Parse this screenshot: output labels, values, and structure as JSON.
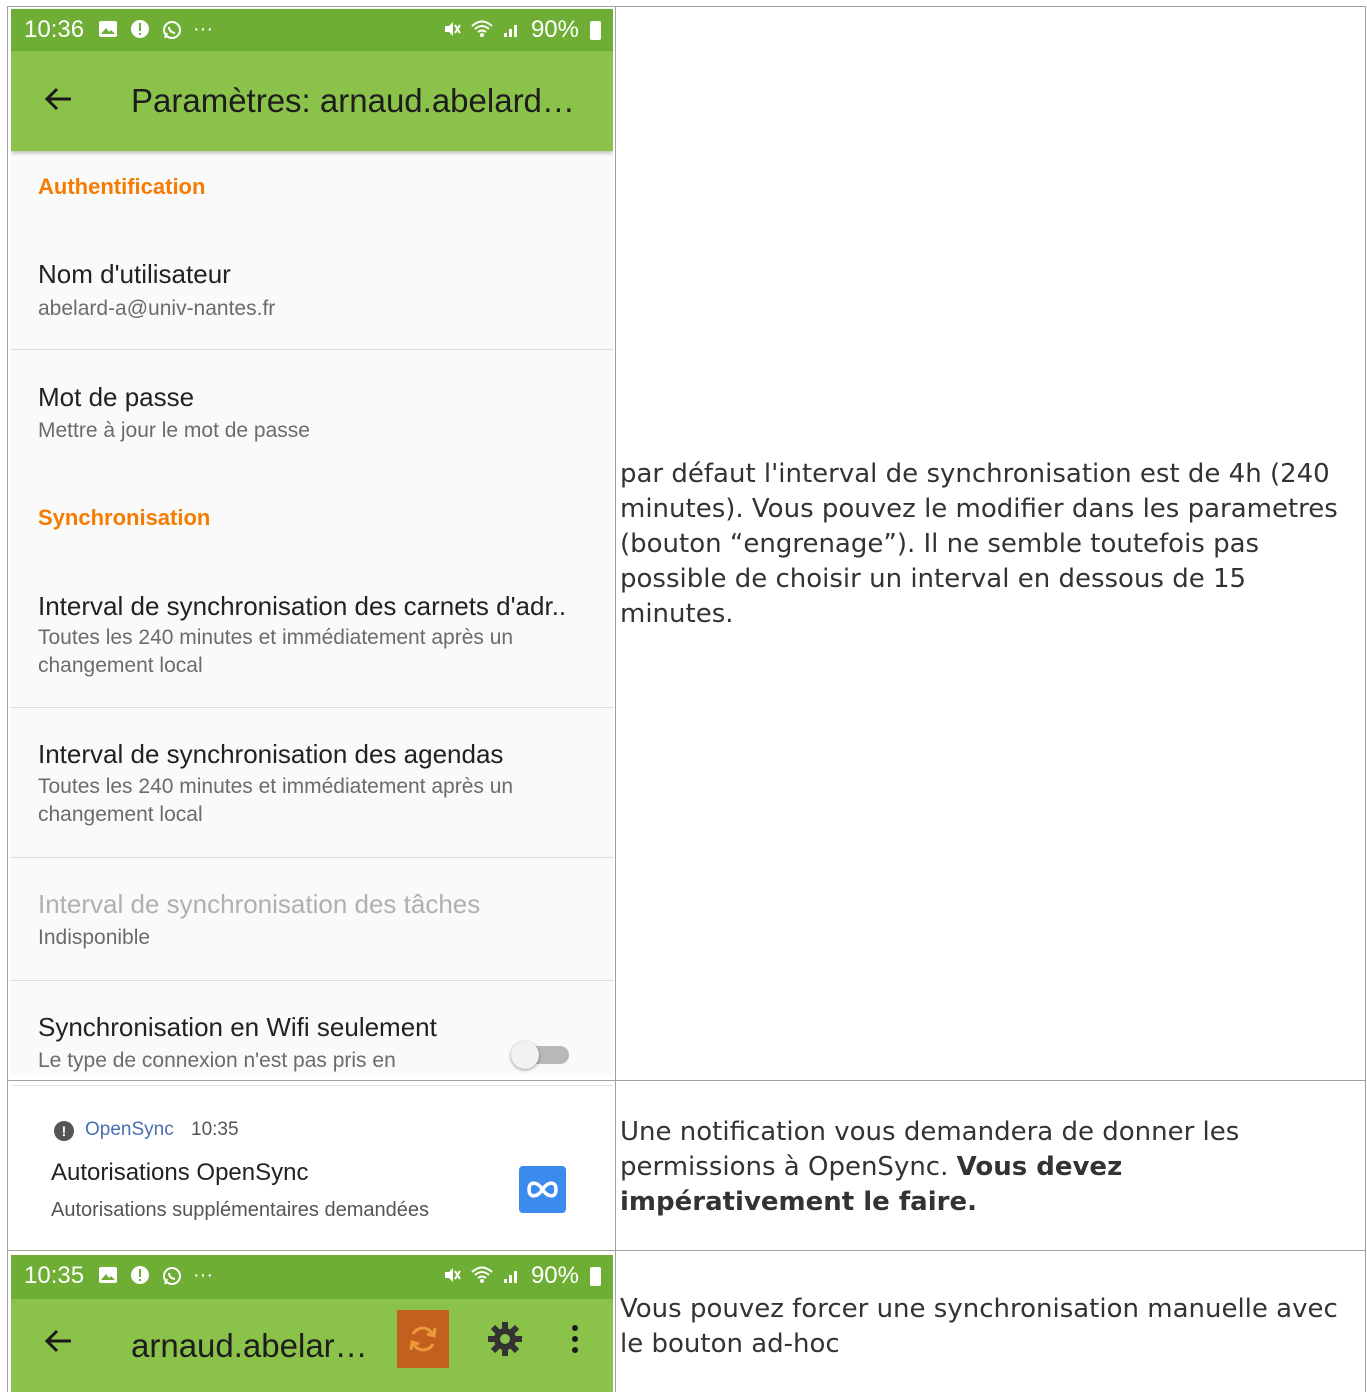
{
  "phone1": {
    "status": {
      "time": "10:36",
      "battery": "90%",
      "more": "···"
    },
    "toolbar": {
      "title": "Paramètres: arnaud.abelard…"
    },
    "sections": {
      "auth": "Authentification",
      "sync": "Synchronisation"
    },
    "prefs": {
      "username": {
        "title": "Nom d'utilisateur",
        "summary": "abelard-a@univ-nantes.fr"
      },
      "password": {
        "title": "Mot de passe",
        "summary": "Mettre à jour le mot de passe"
      },
      "contacts_interval": {
        "title": "Interval de synchronisation des carnets d'adr..",
        "summary": "Toutes les 240 minutes et immédiatement après un changement local"
      },
      "calendar_interval": {
        "title": "Interval de synchronisation des agendas",
        "summary": "Toutes les 240 minutes et immédiatement après un changement local"
      },
      "tasks_interval": {
        "title": "Interval de synchronisation des tâches",
        "summary": "Indisponible"
      },
      "wifi_only": {
        "title": "Synchronisation en Wifi seulement",
        "summary": "Le type de connexion n'est pas pris en",
        "enabled": false
      }
    }
  },
  "notification": {
    "app": "OpenSync",
    "time": "10:35",
    "title": "Autorisations OpenSync",
    "text": "Autorisations supplémentaires demandées"
  },
  "phone2": {
    "status": {
      "time": "10:35",
      "battery": "90%",
      "more": "···"
    },
    "toolbar": {
      "title": "arnaud.abelar…"
    }
  },
  "explanations": {
    "row1": "par défaut l'interval de synchronisation est de 4h (240 minutes). Vous pouvez le modifier dans les parametres (bouton “engrenage”). Il ne semble toutefois pas possible de choisir un interval en dessous de 15 minutes.",
    "row2_plain": "Une notification vous demandera de donner les permissions à OpenSync.",
    "row2_bold": "Vous devez impérativement le faire.",
    "row3": "Vous pouvez forcer une synchronisation manuelle avec le bouton ad-hoc"
  },
  "colors": {
    "accent_orange": "#f57c00",
    "toolbar_green": "#8bc34a",
    "statusbar_green": "#6fae35",
    "sync_highlight": "#c3601d"
  }
}
